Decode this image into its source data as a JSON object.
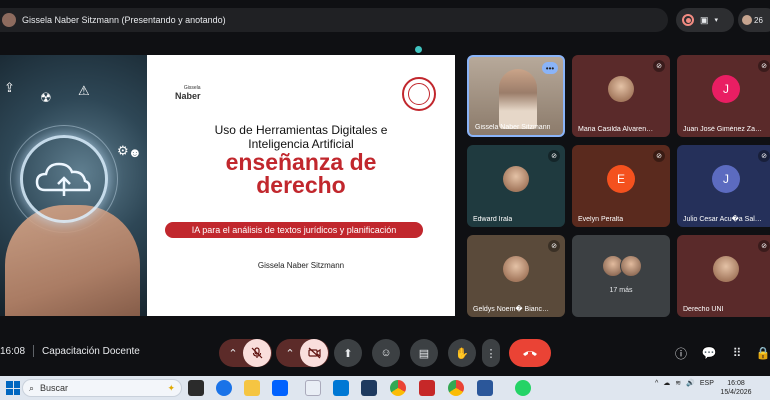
{
  "topbar": {
    "presenter": "Gissela Naber Sitzmann (Presentando y anotando)",
    "participant_count": "26"
  },
  "slide": {
    "logo_small": "Gissela",
    "logo": "Naber",
    "title_line1": "Uso de Herramientas Digitales e",
    "title_line2": "Inteligencia Artificial",
    "big_line1": "enseñanza de",
    "big_line2": "derecho",
    "pill": "IA para el análisis de textos jurídicos y planificación",
    "author": "Gissela Naber Sitzmann"
  },
  "tiles": [
    {
      "name": "Gissela Naber Sitzmann",
      "type": "video",
      "bg": "#8c7b6b"
    },
    {
      "name": "Maria Casilda Alvaren…",
      "type": "face",
      "bg": "#5a2a2a"
    },
    {
      "name": "Juan José Giménez Za…",
      "type": "initial",
      "initial": "J",
      "bg": "#5a2a2a",
      "color": "#e91e63"
    },
    {
      "name": "Edward Irala",
      "type": "face",
      "bg": "#1f3a3f"
    },
    {
      "name": "Evelyn Peralta",
      "type": "initial",
      "initial": "E",
      "bg": "#5a2a1e",
      "color": "#f4511e"
    },
    {
      "name": "Julio Cesar Acu�a Sal…",
      "type": "initial",
      "initial": "J",
      "bg": "#25305a",
      "color": "#5c6bc0"
    },
    {
      "name": "Geldys Noem� Bianc…",
      "type": "face",
      "bg": "#5a4a3a"
    },
    {
      "name": "17 más",
      "type": "more",
      "bg": "#3c4043"
    },
    {
      "name": "Derecho UNI",
      "type": "face",
      "bg": "#5a2a2a"
    }
  ],
  "meeting": {
    "time": "16:08",
    "title": "Capacitación Docente"
  },
  "taskbar": {
    "search_placeholder": "Buscar",
    "lang": "ESP",
    "time": "16:08",
    "date": "15/4/2026"
  },
  "icons": {
    "mic_off": "🎤",
    "cam_off": "📷"
  }
}
